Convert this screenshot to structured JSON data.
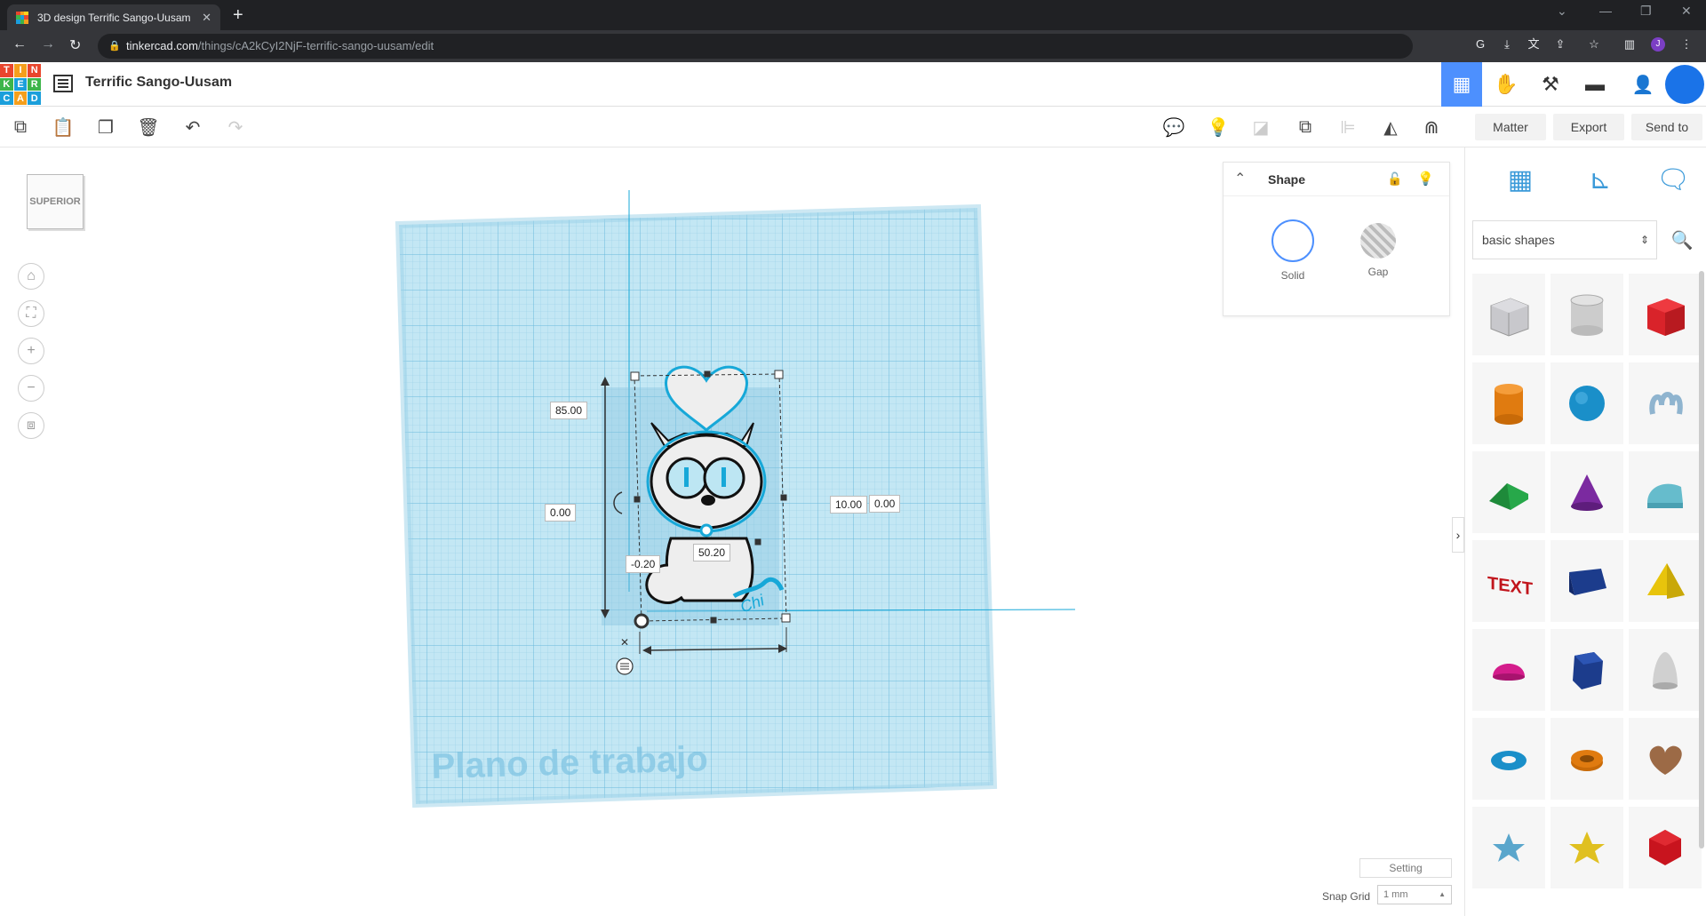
{
  "browser": {
    "tab_title": "3D design Terrific Sango-Uusam",
    "url_host": "tinkercad.com",
    "url_path": "/things/cA2kCyI2NjF-terrific-sango-uusam/edit"
  },
  "app": {
    "logo_letters": [
      "T",
      "I",
      "N",
      "K",
      "E",
      "R",
      "C",
      "A",
      "D"
    ],
    "design_title": "Terrific Sango-Uusam"
  },
  "actions": {
    "matter": "Matter",
    "export": "Export",
    "send_to": "Send to"
  },
  "viewcube": {
    "label": "SUPERIOR"
  },
  "workplane": {
    "label": "Plano de trabajo"
  },
  "dimensions": {
    "height": "85.00",
    "width": "50.20",
    "depth": "10.00",
    "elev_left": "0.00",
    "elev_right": "0.00",
    "offset": "-0.20"
  },
  "shape_panel": {
    "title": "Shape",
    "solid": "Solid",
    "gap": "Gap"
  },
  "library": {
    "category": "basic shapes",
    "shapes": [
      "box-striped",
      "cylinder-striped",
      "box",
      "cylinder",
      "sphere",
      "scribble",
      "roof",
      "cone",
      "round-roof",
      "text",
      "wedge",
      "pyramid",
      "half-sphere",
      "polygon",
      "paraboloid",
      "torus",
      "tube",
      "heart",
      "star",
      "star-gold",
      "icosahedron"
    ]
  },
  "footer": {
    "setting": "Setting",
    "snap_label": "Snap Grid",
    "snap_value": "1 mm"
  },
  "colors": {
    "accent": "#4d90fe",
    "workplane": "#a6dcef",
    "selection": "#17a8d8"
  }
}
